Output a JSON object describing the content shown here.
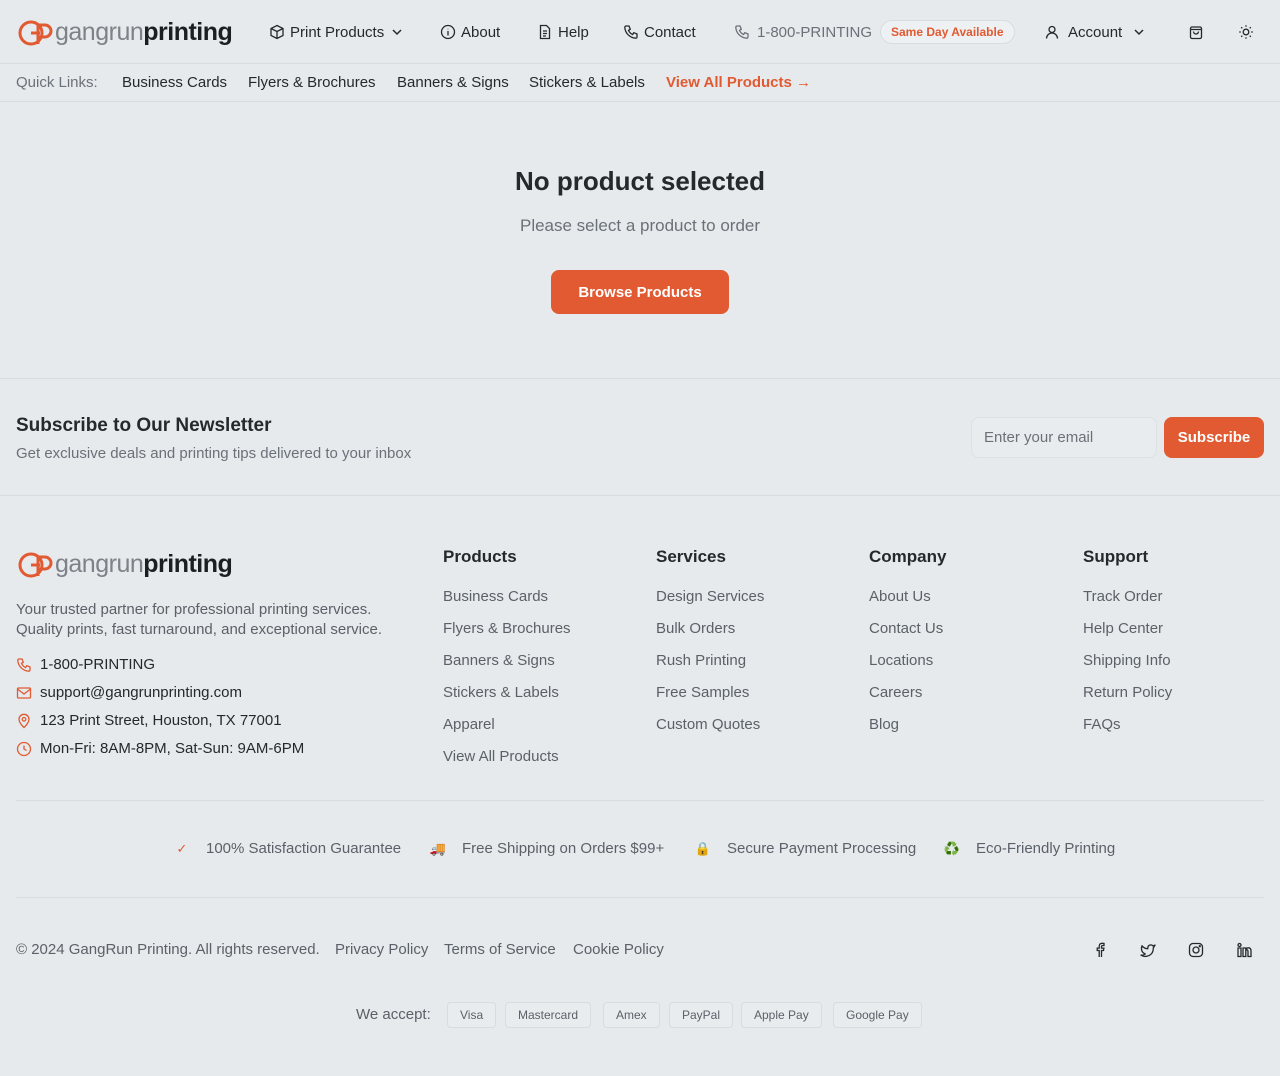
{
  "brand": {
    "name_light": "gangrun",
    "name_bold": "printing",
    "accent": "#e15a32"
  },
  "header": {
    "nav": [
      {
        "label": "Print Products",
        "icon": "box-icon"
      },
      {
        "label": "About",
        "icon": "info-icon"
      },
      {
        "label": "Help",
        "icon": "document-icon"
      },
      {
        "label": "Contact",
        "icon": "phone-icon"
      }
    ],
    "phone": "1-800-PRINTING",
    "badge": "Same Day Available",
    "account": "Account"
  },
  "quick_links": {
    "label": "Quick Links:",
    "items": [
      "Business Cards",
      "Flyers & Brochures",
      "Banners & Signs",
      "Stickers & Labels"
    ],
    "view_all": "View All Products →"
  },
  "empty_state": {
    "title": "No product selected",
    "subtitle": "Please select a product to order",
    "button": "Browse Products"
  },
  "newsletter": {
    "title": "Subscribe to Our Newsletter",
    "subtitle": "Get exclusive deals and printing tips delivered to your inbox",
    "placeholder": "Enter your email",
    "button": "Subscribe"
  },
  "footer": {
    "description_line1": "Your trusted partner for professional printing services.",
    "description_line2": "Quality prints, fast turnaround, and exceptional service.",
    "contact": {
      "phone": "1-800-PRINTING",
      "email": "support@gangrunprinting.com",
      "address": "123 Print Street, Houston, TX 77001",
      "hours": "Mon-Fri: 8AM-8PM, Sat-Sun: 9AM-6PM"
    },
    "columns": [
      {
        "title": "Products",
        "links": [
          "Business Cards",
          "Flyers & Brochures",
          "Banners & Signs",
          "Stickers & Labels",
          "Apparel",
          "View All Products"
        ]
      },
      {
        "title": "Services",
        "links": [
          "Design Services",
          "Bulk Orders",
          "Rush Printing",
          "Free Samples",
          "Custom Quotes"
        ]
      },
      {
        "title": "Company",
        "links": [
          "About Us",
          "Contact Us",
          "Locations",
          "Careers",
          "Blog"
        ]
      },
      {
        "title": "Support",
        "links": [
          "Track Order",
          "Help Center",
          "Shipping Info",
          "Return Policy",
          "FAQs"
        ]
      }
    ],
    "trust": [
      {
        "icon": "✓",
        "label": "100% Satisfaction Guarantee"
      },
      {
        "icon": "🚚",
        "label": "Free Shipping on Orders $99+"
      },
      {
        "icon": "🔒",
        "label": "Secure Payment Processing"
      },
      {
        "icon": "♻️",
        "label": "Eco-Friendly Printing"
      }
    ],
    "copyright": "© 2024 GangRun Printing. All rights reserved.",
    "legal": [
      "Privacy Policy",
      "Terms of Service",
      "Cookie Policy"
    ],
    "accept_label": "We accept:",
    "payments": [
      "Visa",
      "Mastercard",
      "Amex",
      "PayPal",
      "Apple Pay",
      "Google Pay"
    ]
  }
}
